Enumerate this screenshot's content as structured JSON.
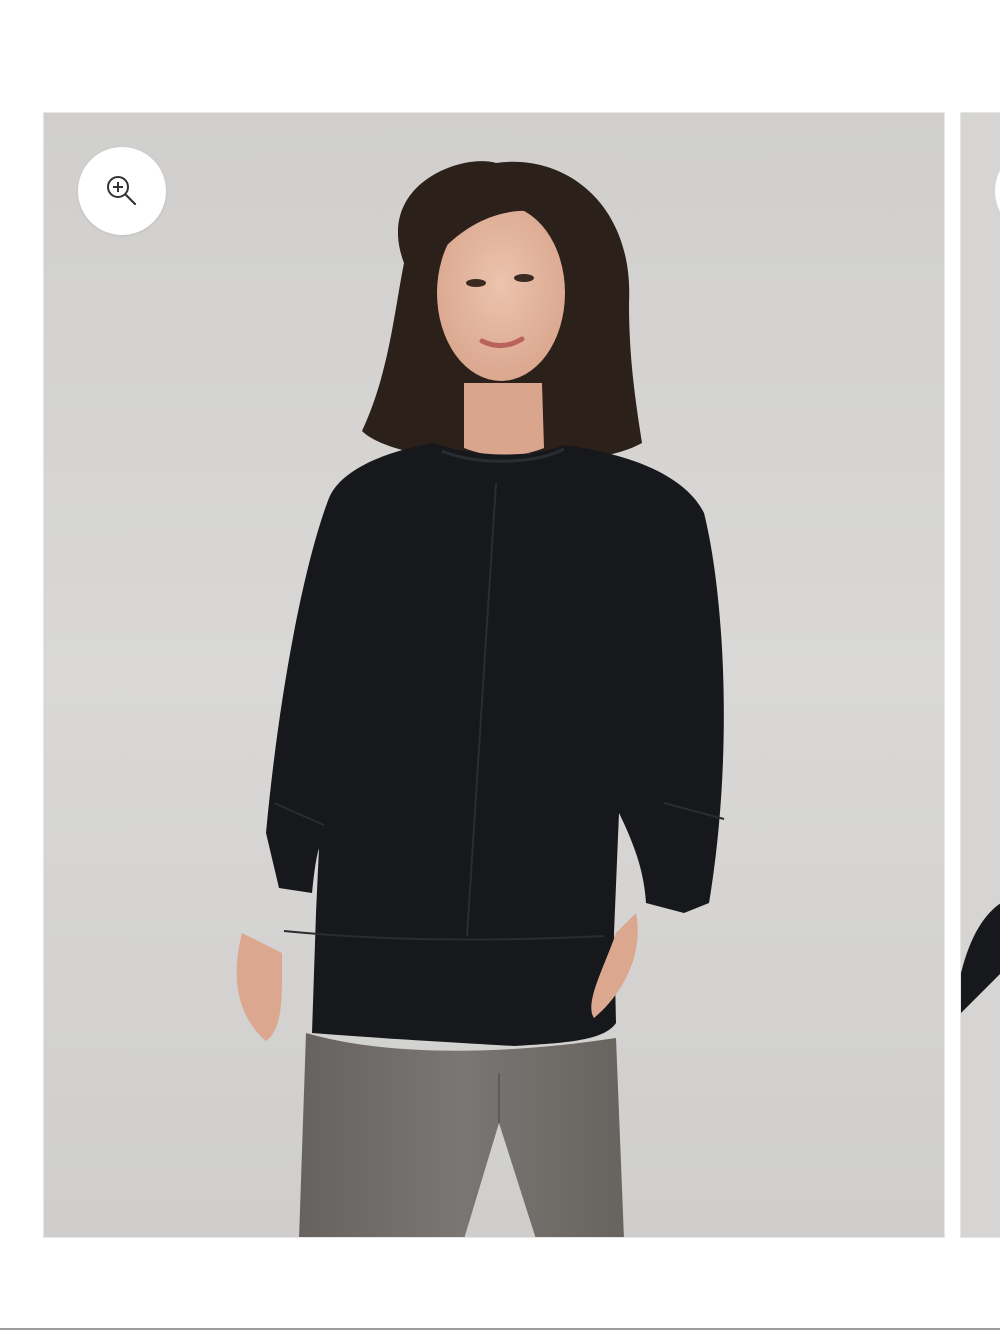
{
  "gallery": {
    "current_slide": 1,
    "slides": [
      {
        "image": "model-wearing-black-three-quarter-sleeve-top-front-view",
        "colors": {
          "background": "#d6d5d3",
          "top": "#15171a",
          "pants": "#6f6b69",
          "hair": "#2b1f1a",
          "skin": "#e3b49c"
        }
      },
      {
        "image": "model-wearing-black-three-quarter-sleeve-top-alternate-view",
        "colors": {
          "background": "#d6d5d3"
        }
      }
    ],
    "zoom_icon": "zoom-in-icon",
    "next_zoom_icon": "zoom-in-icon"
  }
}
